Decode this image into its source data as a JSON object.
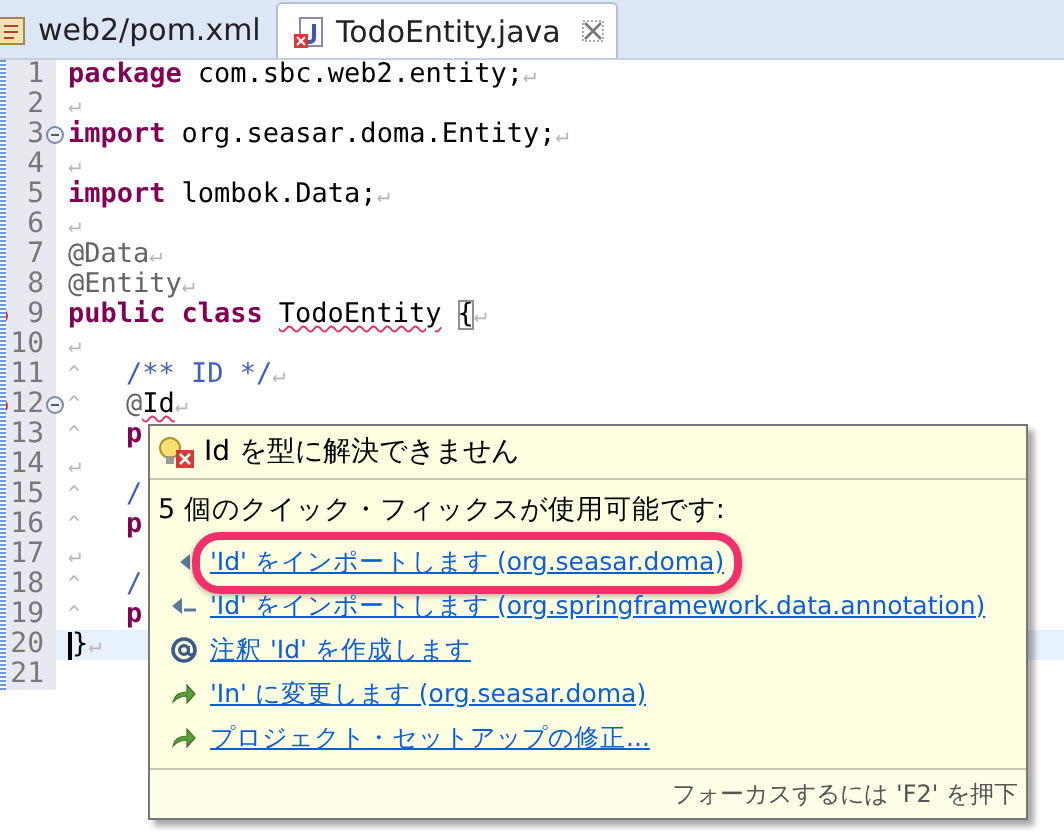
{
  "tabs": [
    {
      "label": "web2/pom.xml",
      "kind": "xml",
      "selected": false
    },
    {
      "label": "TodoEntity.java",
      "kind": "java",
      "selected": true
    }
  ],
  "editor": {
    "lines": [
      {
        "number": "1",
        "segments": [
          {
            "text": "package",
            "kind": "keyword"
          },
          {
            "text": "com.sbc.web2.entity;",
            "kind": "plain",
            "space_before": true
          },
          {
            "text": "↵",
            "kind": "ws"
          }
        ]
      },
      {
        "number": "2",
        "segments": [
          {
            "text": "↵",
            "kind": "ws"
          }
        ]
      },
      {
        "number": "3",
        "fold": true,
        "segments": [
          {
            "text": "import",
            "kind": "keyword"
          },
          {
            "text": "org.seasar.doma.Entity;",
            "kind": "plain",
            "space_before": true
          },
          {
            "text": "↵",
            "kind": "ws"
          }
        ]
      },
      {
        "number": "4",
        "segments": [
          {
            "text": "↵",
            "kind": "ws"
          }
        ]
      },
      {
        "number": "5",
        "segments": [
          {
            "text": "import",
            "kind": "keyword"
          },
          {
            "text": "lombok.Data;",
            "kind": "plain",
            "space_before": true
          },
          {
            "text": "↵",
            "kind": "ws"
          }
        ]
      },
      {
        "number": "6",
        "segments": [
          {
            "text": "↵",
            "kind": "ws"
          }
        ]
      },
      {
        "number": "7",
        "segments": [
          {
            "text": "@Data",
            "kind": "annotation"
          },
          {
            "text": "↵",
            "kind": "ws"
          }
        ]
      },
      {
        "number": "8",
        "segments": [
          {
            "text": "@Entity",
            "kind": "annotation"
          },
          {
            "text": "↵",
            "kind": "ws"
          }
        ]
      },
      {
        "number": "9",
        "error": true,
        "segments": [
          {
            "text": "public",
            "kind": "keyword"
          },
          {
            "text": "class",
            "kind": "keyword",
            "space_before": true
          },
          {
            "text": "TodoEntity",
            "kind": "squiggly",
            "space_before": true
          },
          {
            "text": "{",
            "kind": "bracket",
            "space_before": true
          },
          {
            "text": "↵",
            "kind": "ws"
          }
        ]
      },
      {
        "number": "10",
        "segments": [
          {
            "text": "↵",
            "kind": "ws"
          }
        ]
      },
      {
        "number": "11",
        "segments": [
          {
            "text": "^",
            "kind": "tab"
          },
          {
            "text": "/** ID */",
            "kind": "comment"
          },
          {
            "text": "↵",
            "kind": "ws"
          }
        ]
      },
      {
        "number": "12",
        "fold": true,
        "error": true,
        "segments": [
          {
            "text": "^",
            "kind": "tab"
          },
          {
            "text": "@",
            "kind": "annotation"
          },
          {
            "text": "Id",
            "kind": "squiggly"
          },
          {
            "text": "↵",
            "kind": "ws"
          }
        ]
      },
      {
        "number": "13",
        "segments": [
          {
            "text": "^",
            "kind": "tab"
          },
          {
            "text": "p",
            "kind": "keyword"
          }
        ]
      },
      {
        "number": "14",
        "segments": [
          {
            "text": "↵",
            "kind": "ws"
          }
        ]
      },
      {
        "number": "15",
        "segments": [
          {
            "text": "^",
            "kind": "tab"
          },
          {
            "text": "/",
            "kind": "comment"
          }
        ]
      },
      {
        "number": "16",
        "segments": [
          {
            "text": "^",
            "kind": "tab"
          },
          {
            "text": "p",
            "kind": "keyword"
          }
        ]
      },
      {
        "number": "17",
        "segments": [
          {
            "text": "↵",
            "kind": "ws"
          }
        ]
      },
      {
        "number": "18",
        "segments": [
          {
            "text": "^",
            "kind": "tab"
          },
          {
            "text": "/",
            "kind": "comment"
          }
        ]
      },
      {
        "number": "19",
        "segments": [
          {
            "text": "^",
            "kind": "tab"
          },
          {
            "text": "p",
            "kind": "keyword"
          }
        ]
      },
      {
        "number": "20",
        "current": true,
        "segments": [
          {
            "text": "}",
            "kind": "plain"
          },
          {
            "text": "↵",
            "kind": "ws"
          }
        ]
      },
      {
        "number": "21"
      }
    ]
  },
  "quick_fix": {
    "title": "Id を型に解決できません",
    "heading": "5 個のクイック・フィックスが使用可能です:",
    "fixes": [
      {
        "text": "'Id' をインポートします (org.seasar.doma)",
        "kind": "import",
        "highlighted": true
      },
      {
        "text": "'Id' をインポートします (org.springframework.data.annotation)",
        "kind": "import-alt",
        "highlighted": false
      },
      {
        "text": "注釈 'Id' を作成します",
        "kind": "annotation",
        "highlighted": false
      },
      {
        "text": "'In' に変更します (org.seasar.doma)",
        "kind": "change",
        "highlighted": false
      },
      {
        "text": "プロジェクト・セットアップの修正...",
        "kind": "change",
        "highlighted": false
      }
    ],
    "footer": "フォーカスするには 'F2' を押下"
  }
}
